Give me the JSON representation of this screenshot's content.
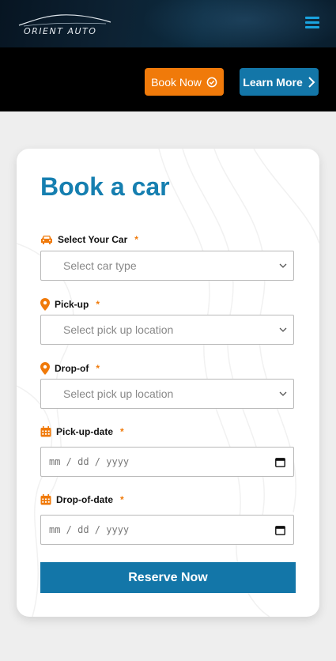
{
  "header": {
    "logo_text": "ORIENT AUTO",
    "menu_icon": "hamburger-icon"
  },
  "hero": {
    "book_now_label": "Book Now",
    "book_now_icon": "check-circle-icon",
    "learn_more_label": "Learn More",
    "learn_more_icon": "chevron-right-icon"
  },
  "form": {
    "title": "Book a car",
    "fields": [
      {
        "label": "Select Your Car",
        "required_mark": "*",
        "icon": "car-icon",
        "placeholder": "Select car type"
      },
      {
        "label": "Pick-up",
        "required_mark": "*",
        "icon": "location-pin-icon",
        "placeholder": "Select pick up location"
      },
      {
        "label": "Drop-of",
        "required_mark": "*",
        "icon": "location-pin-icon",
        "placeholder": "Select pick up location"
      },
      {
        "label": "Pick-up-date",
        "required_mark": "*",
        "icon": "calendar-icon",
        "placeholder": "mm / dd / yyyy"
      },
      {
        "label": "Drop-of-date",
        "required_mark": "*",
        "icon": "calendar-icon",
        "placeholder": "mm / dd / yyyy"
      }
    ],
    "submit_label": "Reserve Now"
  },
  "colors": {
    "accent_orange": "#f07a0a",
    "accent_blue": "#1376a8",
    "title_blue": "#167fb0"
  }
}
